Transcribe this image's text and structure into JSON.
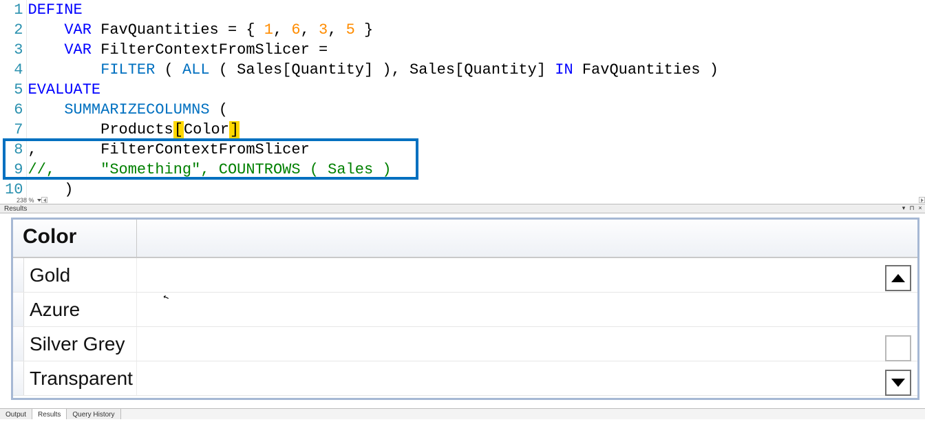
{
  "editor": {
    "zoom_label": "238 %",
    "lines": [
      {
        "n": 1,
        "tokens": [
          {
            "t": "DEFINE",
            "c": "tk-keyword"
          }
        ]
      },
      {
        "n": 2,
        "tokens": [
          {
            "t": "    ",
            "c": "tk-plain"
          },
          {
            "t": "VAR",
            "c": "tk-keyword"
          },
          {
            "t": " FavQuantities = { ",
            "c": "tk-plain"
          },
          {
            "t": "1",
            "c": "tk-num"
          },
          {
            "t": ", ",
            "c": "tk-plain"
          },
          {
            "t": "6",
            "c": "tk-num"
          },
          {
            "t": ", ",
            "c": "tk-plain"
          },
          {
            "t": "3",
            "c": "tk-num"
          },
          {
            "t": ", ",
            "c": "tk-plain"
          },
          {
            "t": "5",
            "c": "tk-num"
          },
          {
            "t": " }",
            "c": "tk-plain"
          }
        ]
      },
      {
        "n": 3,
        "tokens": [
          {
            "t": "    ",
            "c": "tk-plain"
          },
          {
            "t": "VAR",
            "c": "tk-keyword"
          },
          {
            "t": " FilterContextFromSlicer =",
            "c": "tk-plain"
          }
        ]
      },
      {
        "n": 4,
        "tokens": [
          {
            "t": "        ",
            "c": "tk-plain"
          },
          {
            "t": "FILTER",
            "c": "tk-blue"
          },
          {
            "t": " ( ",
            "c": "tk-plain"
          },
          {
            "t": "ALL",
            "c": "tk-blue"
          },
          {
            "t": " ( Sales[Quantity] ), Sales[Quantity] ",
            "c": "tk-plain"
          },
          {
            "t": "IN",
            "c": "tk-keyword"
          },
          {
            "t": " FavQuantities )",
            "c": "tk-plain"
          }
        ]
      },
      {
        "n": 5,
        "tokens": [
          {
            "t": "EVALUATE",
            "c": "tk-keyword"
          }
        ]
      },
      {
        "n": 6,
        "tokens": [
          {
            "t": "    ",
            "c": "tk-plain"
          },
          {
            "t": "SUMMARIZECOLUMNS",
            "c": "tk-blue"
          },
          {
            "t": " (",
            "c": "tk-plain"
          }
        ]
      },
      {
        "n": 7,
        "tokens": [
          {
            "t": "        Products",
            "c": "tk-plain"
          },
          {
            "t": "[",
            "c": "bracket-hl"
          },
          {
            "t": "Color",
            "c": "tk-plain"
          },
          {
            "t": "]",
            "c": "bracket-hl"
          }
        ]
      },
      {
        "n": 8,
        "tokens": [
          {
            "t": ",       FilterContextFromSlicer",
            "c": "tk-plain"
          }
        ]
      },
      {
        "n": 9,
        "tokens": [
          {
            "t": "//,     \"Something\", COUNTROWS ( Sales )",
            "c": "tk-comment"
          }
        ]
      },
      {
        "n": 10,
        "tokens": [
          {
            "t": "    )",
            "c": "tk-plain"
          }
        ]
      }
    ]
  },
  "results": {
    "panel_title": "Results",
    "column_header": "Color",
    "rows": [
      "Gold",
      "Azure",
      "Silver Grey",
      "Transparent"
    ]
  },
  "tabs": {
    "output": "Output",
    "results": "Results",
    "history": "Query History"
  }
}
